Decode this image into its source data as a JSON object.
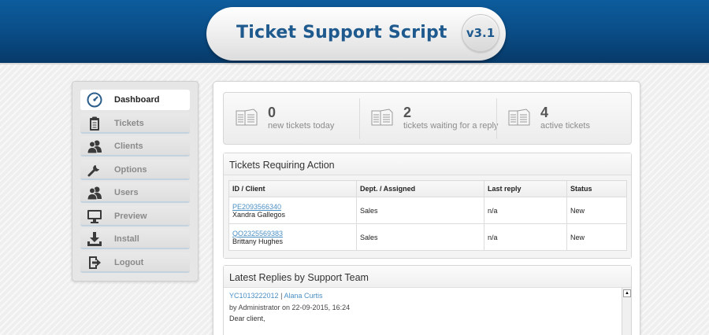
{
  "header": {
    "title": "Ticket Support Script",
    "version": "v3.1"
  },
  "sidebar": {
    "items": [
      {
        "label": "Dashboard",
        "icon": "dashboard-gauge-icon",
        "active": true
      },
      {
        "label": "Tickets",
        "icon": "clipboard-icon",
        "active": false
      },
      {
        "label": "Clients",
        "icon": "users-icon",
        "active": false
      },
      {
        "label": "Options",
        "icon": "wrench-icon",
        "active": false
      },
      {
        "label": "Users",
        "icon": "users-icon",
        "active": false
      },
      {
        "label": "Preview",
        "icon": "monitor-icon",
        "active": false
      },
      {
        "label": "Install",
        "icon": "download-icon",
        "active": false
      },
      {
        "label": "Logout",
        "icon": "logout-icon",
        "active": false
      }
    ]
  },
  "stats": [
    {
      "value": "0",
      "label": "new tickets today",
      "icon": "documents-icon"
    },
    {
      "value": "2",
      "label": "tickets waiting for a reply",
      "icon": "documents-icon"
    },
    {
      "value": "4",
      "label": "active tickets",
      "icon": "documents-icon"
    }
  ],
  "tickets_box": {
    "title": "Tickets Requiring Action",
    "columns": [
      "ID / Client",
      "Dept. / Assigned",
      "Last reply",
      "Status"
    ],
    "rows": [
      {
        "id": "PE2093566340",
        "client": "Xandra Gallegos",
        "dept": "Sales",
        "last_reply": "n/a",
        "status": "New"
      },
      {
        "id": "QO2325569383",
        "client": "Brittany Hughes",
        "dept": "Sales",
        "last_reply": "n/a",
        "status": "New"
      }
    ]
  },
  "replies_box": {
    "title": "Latest Replies by Support Team",
    "reply": {
      "ticket_id": "YC1013222012",
      "separator": "|",
      "client": "Alana Curtis",
      "meta": "by Administrator on 22-09-2015, 16:24",
      "text": "Dear client,"
    }
  },
  "colors": {
    "header_blue": "#0a4f8a",
    "brand_text": "#1f5a8e",
    "link": "#4a8fc4"
  }
}
